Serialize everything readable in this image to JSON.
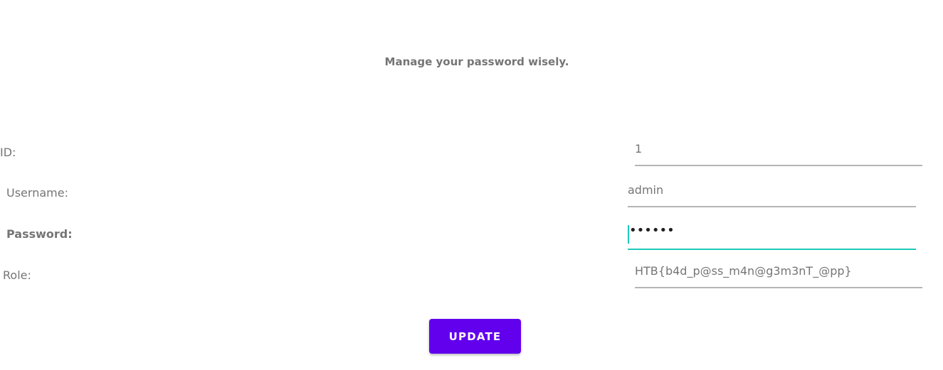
{
  "screen": {
    "heading": "Manage your password wisely."
  },
  "form": {
    "id": {
      "label": "ID:",
      "value": "1"
    },
    "username": {
      "label": "Username:",
      "value": "admin"
    },
    "password": {
      "label": "Password:",
      "value": "••••••"
    },
    "role": {
      "label": "Role:",
      "value": "HTB{b4d_p@ss_m4n@g3m3nT_@pp}"
    }
  },
  "actions": {
    "update_label": "UPDATE"
  },
  "colors": {
    "accent": "#6200ee",
    "focus": "#1ec9b9",
    "text": "#757575",
    "underline": "#b5b5b5"
  }
}
